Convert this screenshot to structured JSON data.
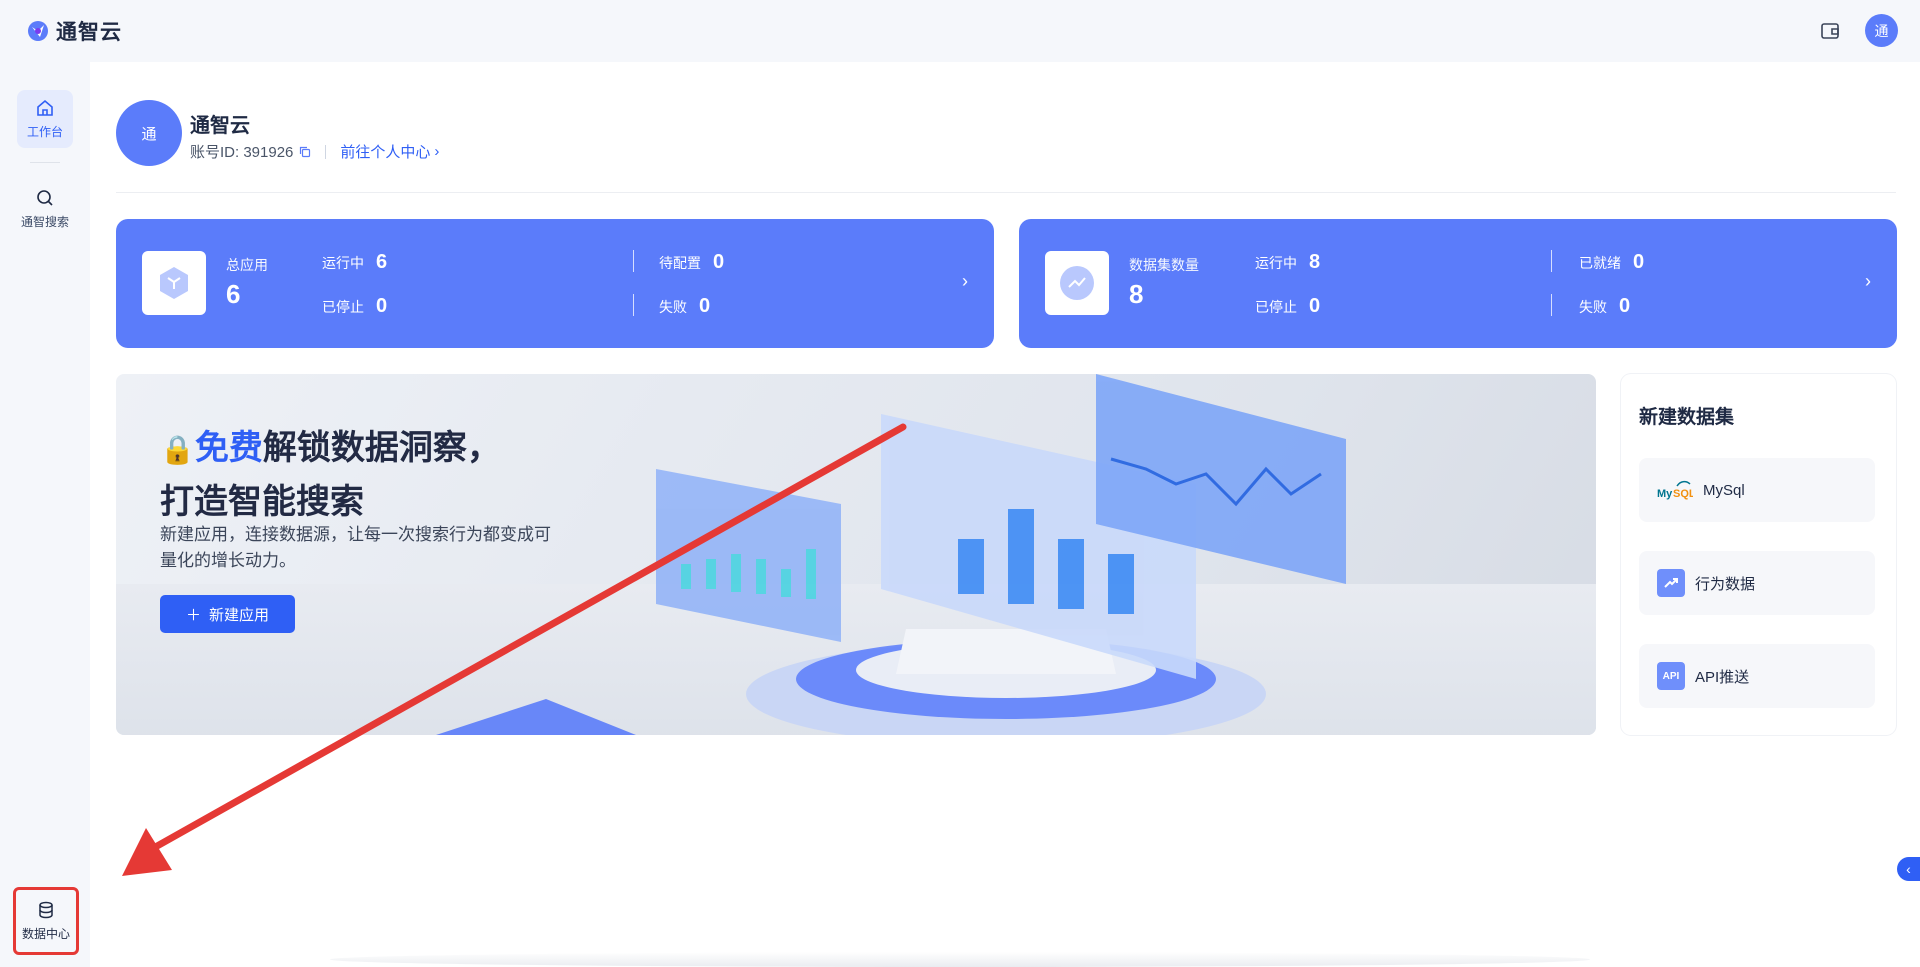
{
  "app": {
    "title": "通智云",
    "user_initial": "通"
  },
  "sidebar": {
    "items": [
      {
        "label": "工作台",
        "icon": "home-icon"
      },
      {
        "label": "通智搜索",
        "icon": "search-icon"
      }
    ],
    "bottom": {
      "label": "数据中心",
      "icon": "database-icon"
    }
  },
  "profile": {
    "initial": "通",
    "name": "通智云",
    "account_id": "账号ID: 391926",
    "link_label": "前往个人中心"
  },
  "app_stats": {
    "label": "总应用",
    "total": "6",
    "metrics": [
      {
        "label": "运行中",
        "value": "6"
      },
      {
        "label": "已停止",
        "value": "0"
      },
      {
        "label": "待配置",
        "value": "0"
      },
      {
        "label": "失败",
        "value": "0"
      }
    ]
  },
  "dataset_stats": {
    "label": "数据集数量",
    "total": "8",
    "metrics": [
      {
        "label": "运行中",
        "value": "8"
      },
      {
        "label": "已停止",
        "value": "0"
      },
      {
        "label": "已就绪",
        "value": "0"
      },
      {
        "label": "失败",
        "value": "0"
      }
    ]
  },
  "banner": {
    "headline_highlight": "免费",
    "headline_rest": "解锁数据洞察，",
    "headline_line2": "打造智能搜索",
    "subtext": "新建应用，连接数据源，让每一次搜索行为都变成可量化的增长动力。",
    "button_label": "新建应用"
  },
  "new_dataset": {
    "title": "新建数据集",
    "items": [
      {
        "label": "MySql",
        "icon": "mysql-icon"
      },
      {
        "label": "行为数据",
        "icon": "trend-icon"
      },
      {
        "label": "API推送",
        "icon": "api-icon",
        "badge": "API"
      }
    ]
  },
  "colors": {
    "accent": "#2f5ff5",
    "card": "#5b7cfa",
    "annotation": "#e53935"
  }
}
